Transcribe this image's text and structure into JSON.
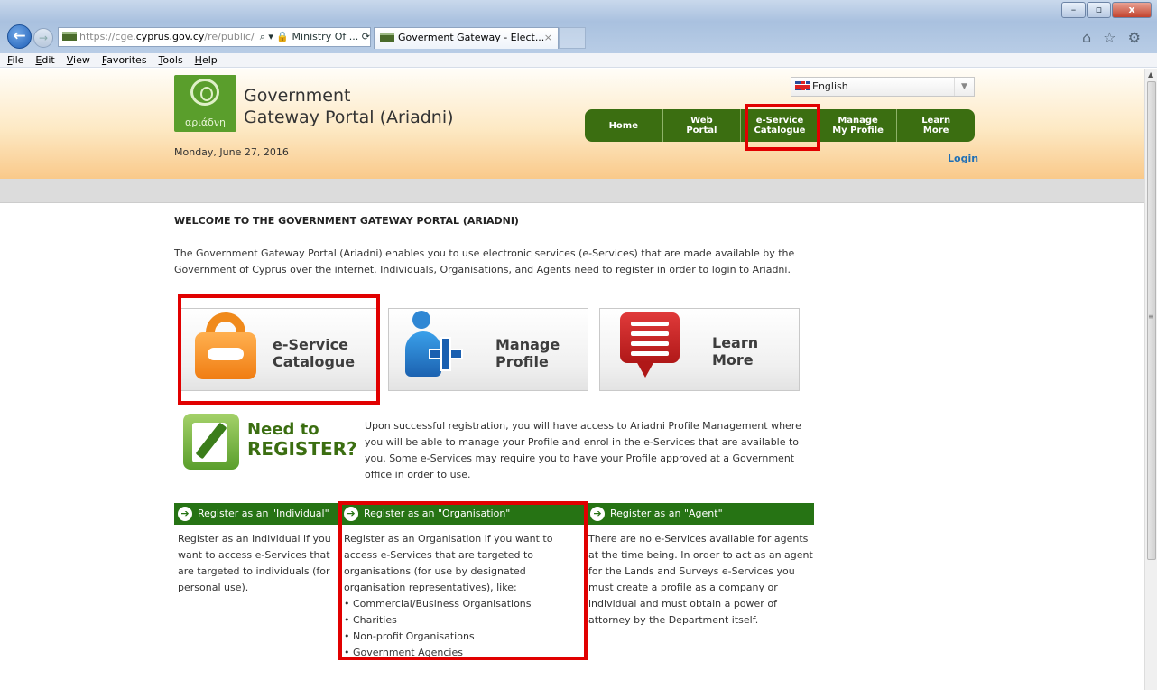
{
  "browser": {
    "address_prefix": "https://cge.",
    "address_host": "cyprus.gov.cy",
    "address_path": "/re/public/",
    "address_controls": "⌕ ▾ 🔒 Ministry Of ... ⟳ ✕",
    "tab_title": "Goverment Gateway - Elect...",
    "tab_close": "×",
    "menu": [
      "File",
      "Edit",
      "View",
      "Favorites",
      "Tools",
      "Help"
    ],
    "toolbar_icons": "⌂ ☆ ⚙"
  },
  "header": {
    "logo_word": "αριάδνη",
    "title_line1": "Government",
    "title_line2": "Gateway Portal (Ariadni)",
    "date": "Monday, June 27, 2016",
    "language": "English",
    "login": "Login"
  },
  "nav": [
    {
      "line1": "Home",
      "line2": ""
    },
    {
      "line1": "Web",
      "line2": "Portal"
    },
    {
      "line1": "e-Service",
      "line2": "Catalogue"
    },
    {
      "line1": "Manage",
      "line2": "My Profile"
    },
    {
      "line1": "Learn",
      "line2": "More"
    }
  ],
  "welcome": {
    "heading": "WELCOME TO THE GOVERNMENT GATEWAY PORTAL (ARIADNI)",
    "intro": "The Government Gateway Portal (Ariadni) enables you to use electronic services (e-Services) that are made available by the Government of Cyprus over the internet. Individuals, Organisations, and Agents need to register in order to login to Ariadni."
  },
  "tiles": [
    {
      "line1": "e-Service",
      "line2": "Catalogue"
    },
    {
      "line1": "Manage",
      "line2": "Profile"
    },
    {
      "line1": "Learn",
      "line2": "More"
    }
  ],
  "register": {
    "title_a": "Need to",
    "title_b": "REGISTER?",
    "text": "Upon successful registration, you will have access to Ariadni Profile Management where you will be able to manage your Profile and enrol in the e-Services that are available to you. Some e-Services may require you to have your Profile approved at a Government office in order to use."
  },
  "columns": [
    {
      "heading": "Register as an \"Individual\"",
      "text": "Register as an Individual if you want to access e-Services that are targeted to individuals (for personal use)."
    },
    {
      "heading": "Register as an \"Organisation\"",
      "text": "Register as an Organisation if you want to access e-Services that are targeted to organisations (for use by designated organisation representatives), like:",
      "items": [
        "Commercial/Business Organisations",
        "Charities",
        "Non-profit Organisations",
        "Government Agencies"
      ]
    },
    {
      "heading": "Register as an \"Agent\"",
      "text": "There are no e-Services available for agents at the time being. In order to act as an agent for the Lands and Surveys e-Services you must create a profile as a company or individual and must obtain a power of attorney by the Department itself."
    }
  ],
  "colors": {
    "nav_green": "#3b6e11",
    "heading_green": "#267314",
    "highlight_red": "#e10000",
    "link_blue": "#1f6fb5"
  }
}
